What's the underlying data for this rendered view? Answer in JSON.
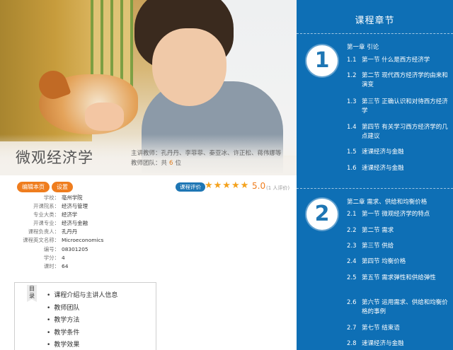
{
  "course": {
    "title": "微观经济学",
    "teachers_label": "主讲教师：孔丹丹、李菲菲、秦亚冰、许正松、蒋伟娜等",
    "team_label": "教师团队：共",
    "team_count": "6",
    "team_unit": "位"
  },
  "buttons": {
    "edit": "编辑本页",
    "settings": "设置"
  },
  "rating": {
    "tag": "课程评价",
    "stars": "★★★★★",
    "score": "5.0",
    "count": "(1 人评价)"
  },
  "info": [
    {
      "k": "学校：",
      "v": "亳州学院"
    },
    {
      "k": "开课院系：",
      "v": "经济与管理"
    },
    {
      "k": "专业大类：",
      "v": "经济学"
    },
    {
      "k": "开课专业：",
      "v": "经济与金融"
    },
    {
      "k": "课程负责人：",
      "v": "孔丹丹"
    },
    {
      "k": "课程英文名称：",
      "v": "Microeconomics"
    },
    {
      "k": "编号：",
      "v": "08301205"
    },
    {
      "k": "学分：",
      "v": "4"
    },
    {
      "k": "课时：",
      "v": "64"
    }
  ],
  "toc": {
    "badge": "目录",
    "items": [
      "课程介绍与主讲人信息",
      "教师团队",
      "教学方法",
      "教学条件",
      "教学效果"
    ]
  },
  "chapters": {
    "title": "课程章节",
    "ch1": {
      "num": "1",
      "head": "第一章 引论",
      "sections": [
        {
          "n": "1.1",
          "t": "第一节 什么是西方经济学"
        },
        {
          "n": "1.2",
          "t": "第二节 现代西方经济学的由来和演变"
        },
        {
          "n": "1.3",
          "t": "第三节 正确认识和对待西方经济学"
        },
        {
          "n": "1.4",
          "t": "第四节 有关学习西方经济学的几点建议"
        },
        {
          "n": "1.5",
          "t": "速课经济与金融"
        },
        {
          "n": "1.6",
          "t": "速课经济与金融"
        }
      ]
    },
    "ch2": {
      "num": "2",
      "head": "第二章 需求、供给和均衡价格",
      "sections": [
        {
          "n": "2.1",
          "t": "第一节 微观经济学的特点"
        },
        {
          "n": "2.2",
          "t": "第二节 需求"
        },
        {
          "n": "2.3",
          "t": "第三节 供给"
        },
        {
          "n": "2.4",
          "t": "第四节 均衡价格"
        },
        {
          "n": "2.5",
          "t": "第五节 需求弹性和供给弹性"
        },
        {
          "n": "2.6",
          "t": "第六节 运用需求、供给和均衡价格的事例"
        },
        {
          "n": "2.7",
          "t": "第七节 结束语"
        },
        {
          "n": "2.8",
          "t": "速课经济与金融"
        }
      ]
    }
  }
}
